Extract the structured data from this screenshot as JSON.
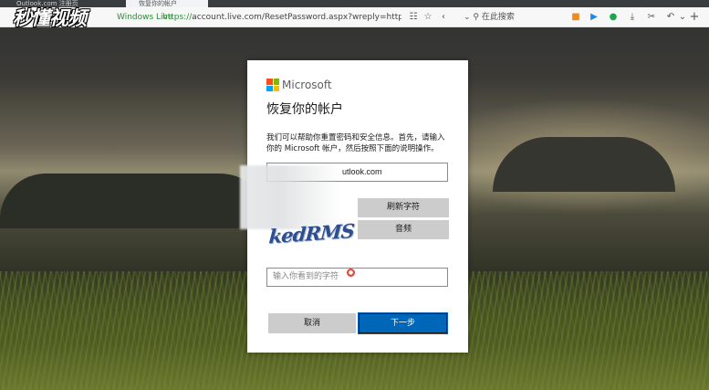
{
  "browser": {
    "tabs": [
      {
        "label": "Outlook.com 注册页"
      },
      {
        "label": "恢复你的帐户"
      }
    ],
    "security_label": "Windows Live",
    "url_scheme": "https://",
    "url_rest": "account.live.com/ResetPassword.aspx?wreply=https://login.live.c",
    "search_placeholder": "在此搜索",
    "toolbar_icons": [
      "expand-icon",
      "star-icon",
      "back-icon",
      "video-icon",
      "play-icon",
      "chat-icon",
      "download-icon",
      "scissors-icon",
      "undo-icon",
      "more-icon",
      "new-tab-icon"
    ]
  },
  "watermark": {
    "logo_text": "秒懂视频"
  },
  "dialog": {
    "brand": "Microsoft",
    "title": "恢复你的帐户",
    "description": "我们可以帮助你重置密码和安全信息。首先，请输入你的 Microsoft 帐户，然后按照下面的说明操作。",
    "email_value": "utlook.com",
    "captcha_text": "kedRMS",
    "refresh_label": "刷新字符",
    "audio_label": "音频",
    "captcha_placeholder": "输入你看到的字符",
    "cancel_label": "取消",
    "next_label": "下一步",
    "logo_colors": [
      "#f25022",
      "#7fba00",
      "#00a4ef",
      "#ffb900"
    ],
    "accent_color": "#0067b8"
  }
}
